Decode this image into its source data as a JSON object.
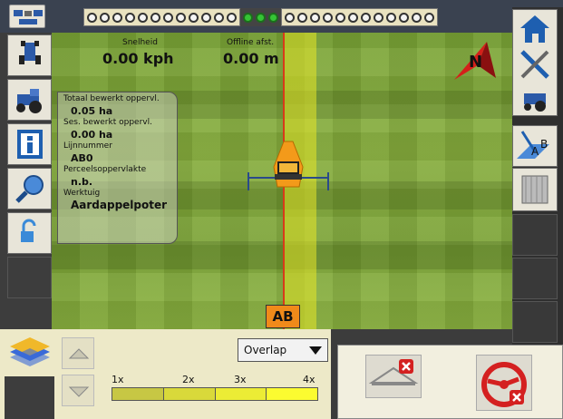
{
  "map": {
    "speed_label": "Snelheid",
    "speed_value": "0.00 kph",
    "offline_label": "Offline afst.",
    "offline_value": "0.00 m",
    "ab_label": "AB",
    "compass_label": "N"
  },
  "info_panel": {
    "items": [
      {
        "label": "Totaal bewerkt oppervl.",
        "value": "0.05 ha"
      },
      {
        "label": "Ses. bewerkt oppervl.",
        "value": "0.00 ha"
      },
      {
        "label": "Lijnnummer",
        "value": "AB0"
      },
      {
        "label": "Perceelsoppervlakte",
        "value": "n.b."
      },
      {
        "label": "Werktuig",
        "value": "Aardappelpoter"
      }
    ]
  },
  "led_bar": {
    "left_count": 12,
    "on_count": 3,
    "right_count": 12
  },
  "bottom": {
    "overlap_select": "Overlap",
    "scale_labels": [
      "1x",
      "2x",
      "3x",
      "4x"
    ],
    "scale_colors": [
      "#c7c744",
      "#d9d93a",
      "#ecec35",
      "#fbfb30"
    ]
  },
  "right_sidebar": {
    "ab_button_label": "B",
    "ab_button_label_a": "A"
  },
  "colors": {
    "guide": "#d83a1a",
    "track": "#e6e628",
    "led_on": "#35c435"
  }
}
